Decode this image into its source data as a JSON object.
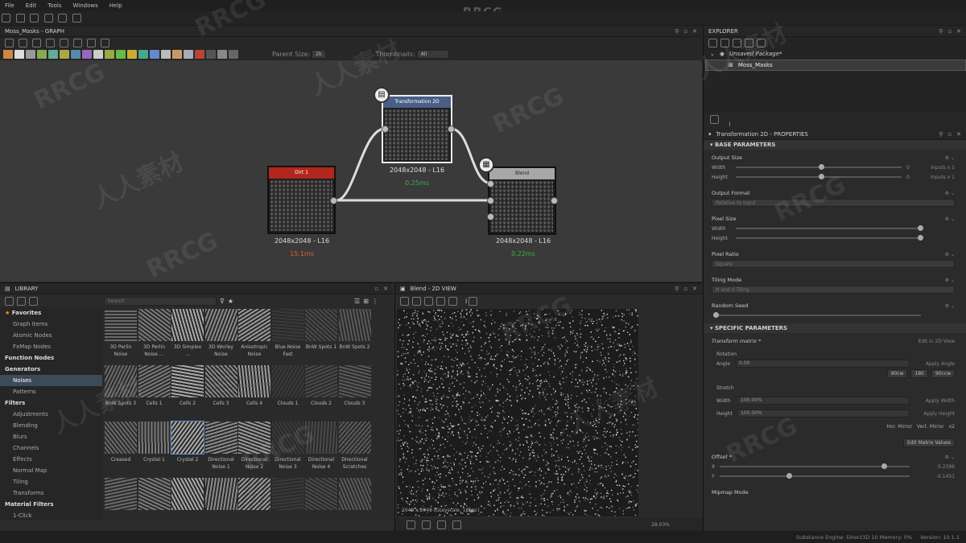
{
  "brand": "RRCG",
  "menu": [
    "File",
    "Edit",
    "Tools",
    "Windows",
    "Help"
  ],
  "graph": {
    "title": "Moss_Masks - GRAPH",
    "parent_size_label": "Parent Size:",
    "parent_size_value": "2k",
    "thumbnails_label": "Thumbnails:",
    "thumbnails_value": "All",
    "nodes": [
      {
        "title": "Dirt 1",
        "color": "#b3261e",
        "size": "2048x2048 - L16",
        "time": "15.1ms",
        "time_color": "#e06030"
      },
      {
        "title": "Transformation 2D",
        "color": "#4a5e86",
        "size": "2048x2048 - L16",
        "time": "0.25ms",
        "time_color": "#3cb043"
      },
      {
        "title": "Blend",
        "color": "#a7a7a7",
        "size": "2048x2048 - L16",
        "time": "0.22ms",
        "time_color": "#3cb043"
      }
    ]
  },
  "explorer": {
    "title": "EXPLORER",
    "package": "Unsaved Package*",
    "graph_item": "Moss_Masks"
  },
  "properties": {
    "title": "Transformation 2D - PROPERTIES",
    "base_section": "BASE PARAMETERS",
    "output_size": "Output Size",
    "width_label": "Width",
    "height_label": "Height",
    "width_value": "0",
    "height_value": "0",
    "width_suffix": "Inputs x 1",
    "height_suffix": "Inputs x 1",
    "output_format": "Output Format",
    "output_format_value": "Relative to Input",
    "pixel_size": "Pixel Size",
    "pixel_ratio": "Pixel Ratio",
    "pixel_ratio_value": "Square",
    "tiling_mode": "Tiling Mode",
    "tiling_mode_value": "H and V Tiling",
    "random_seed": "Random Seed",
    "specific_section": "SPECIFIC PARAMETERS",
    "transform_matrix": "Transform matrix *",
    "edit_2d_view": "Edit in 2D View",
    "rotation": "Rotation",
    "angle_label": "Angle",
    "angle_value": "0.00",
    "apply_angle": "Apply Angle",
    "angle_presets": [
      "90cw",
      "180",
      "90ccw"
    ],
    "stretch": "Stretch",
    "stretch_width_label": "Width",
    "stretch_width_value": "100.00%",
    "apply_width": "Apply Width",
    "stretch_height_label": "Height",
    "stretch_height_value": "100.00%",
    "apply_height": "Apply Height",
    "mirror_h": "Hor. Mirror",
    "mirror_v": "Vert. Mirror",
    "x2": "x2",
    "edit_matrix": "Edit Matrix Values",
    "offset": "Offset *",
    "offset_x_label": "X",
    "offset_y_label": "Y",
    "offset_x": "0.2396",
    "offset_y": "-0.1451",
    "mipmap_mode": "Mipmap Mode"
  },
  "library": {
    "title": "LIBRARY",
    "search_placeholder": "Search",
    "tree": [
      {
        "label": "Favorites",
        "type": "cat"
      },
      {
        "label": "Graph Items",
        "type": "item"
      },
      {
        "label": "Atomic Nodes",
        "type": "item"
      },
      {
        "label": "FxMap Nodes",
        "type": "item"
      },
      {
        "label": "Function Nodes",
        "type": "cat"
      },
      {
        "label": "Generators",
        "type": "cat"
      },
      {
        "label": "Noises",
        "type": "sel"
      },
      {
        "label": "Patterns",
        "type": "item"
      },
      {
        "label": "Filters",
        "type": "cat"
      },
      {
        "label": "Adjustments",
        "type": "item"
      },
      {
        "label": "Blending",
        "type": "item"
      },
      {
        "label": "Blurs",
        "type": "item"
      },
      {
        "label": "Channels",
        "type": "item"
      },
      {
        "label": "Effects",
        "type": "item"
      },
      {
        "label": "Normal Map",
        "type": "item"
      },
      {
        "label": "Tiling",
        "type": "item"
      },
      {
        "label": "Transforms",
        "type": "item"
      },
      {
        "label": "Material Filters",
        "type": "cat"
      },
      {
        "label": "1-Click",
        "type": "item"
      }
    ],
    "items": [
      "3D Perlin Noise",
      "3D Perlin Noise ...",
      "3D Simplex ...",
      "3D Worley Noise",
      "Anisotropic Noise",
      "Blue Noise Fast",
      "BnW Spots 1",
      "BnW Spots 2",
      "BnW Spots 3",
      "Cells 1",
      "Cells 2",
      "Cells 3",
      "Cells 4",
      "Clouds 1",
      "Clouds 2",
      "Clouds 3",
      "Creased",
      "Crystal 1",
      "Crystal 2",
      "Directional Noise 1",
      "Directional Noise 2",
      "Directional Noise 3",
      "Directional Noise 4",
      "Directional Scratches",
      "",
      "",
      "",
      "",
      "",
      "",
      "",
      ""
    ]
  },
  "view2d": {
    "title": "Blend - 2D VIEW",
    "info": "2048 x 2048 (Grayscale, 16bpc)",
    "zoom": "28.03%"
  },
  "status": {
    "engine": "Substance Engine: Direct3D 10  Memory: 0%",
    "version": "Version: 10.1.1"
  },
  "watermarks": [
    "RRCG",
    "人人素材"
  ]
}
